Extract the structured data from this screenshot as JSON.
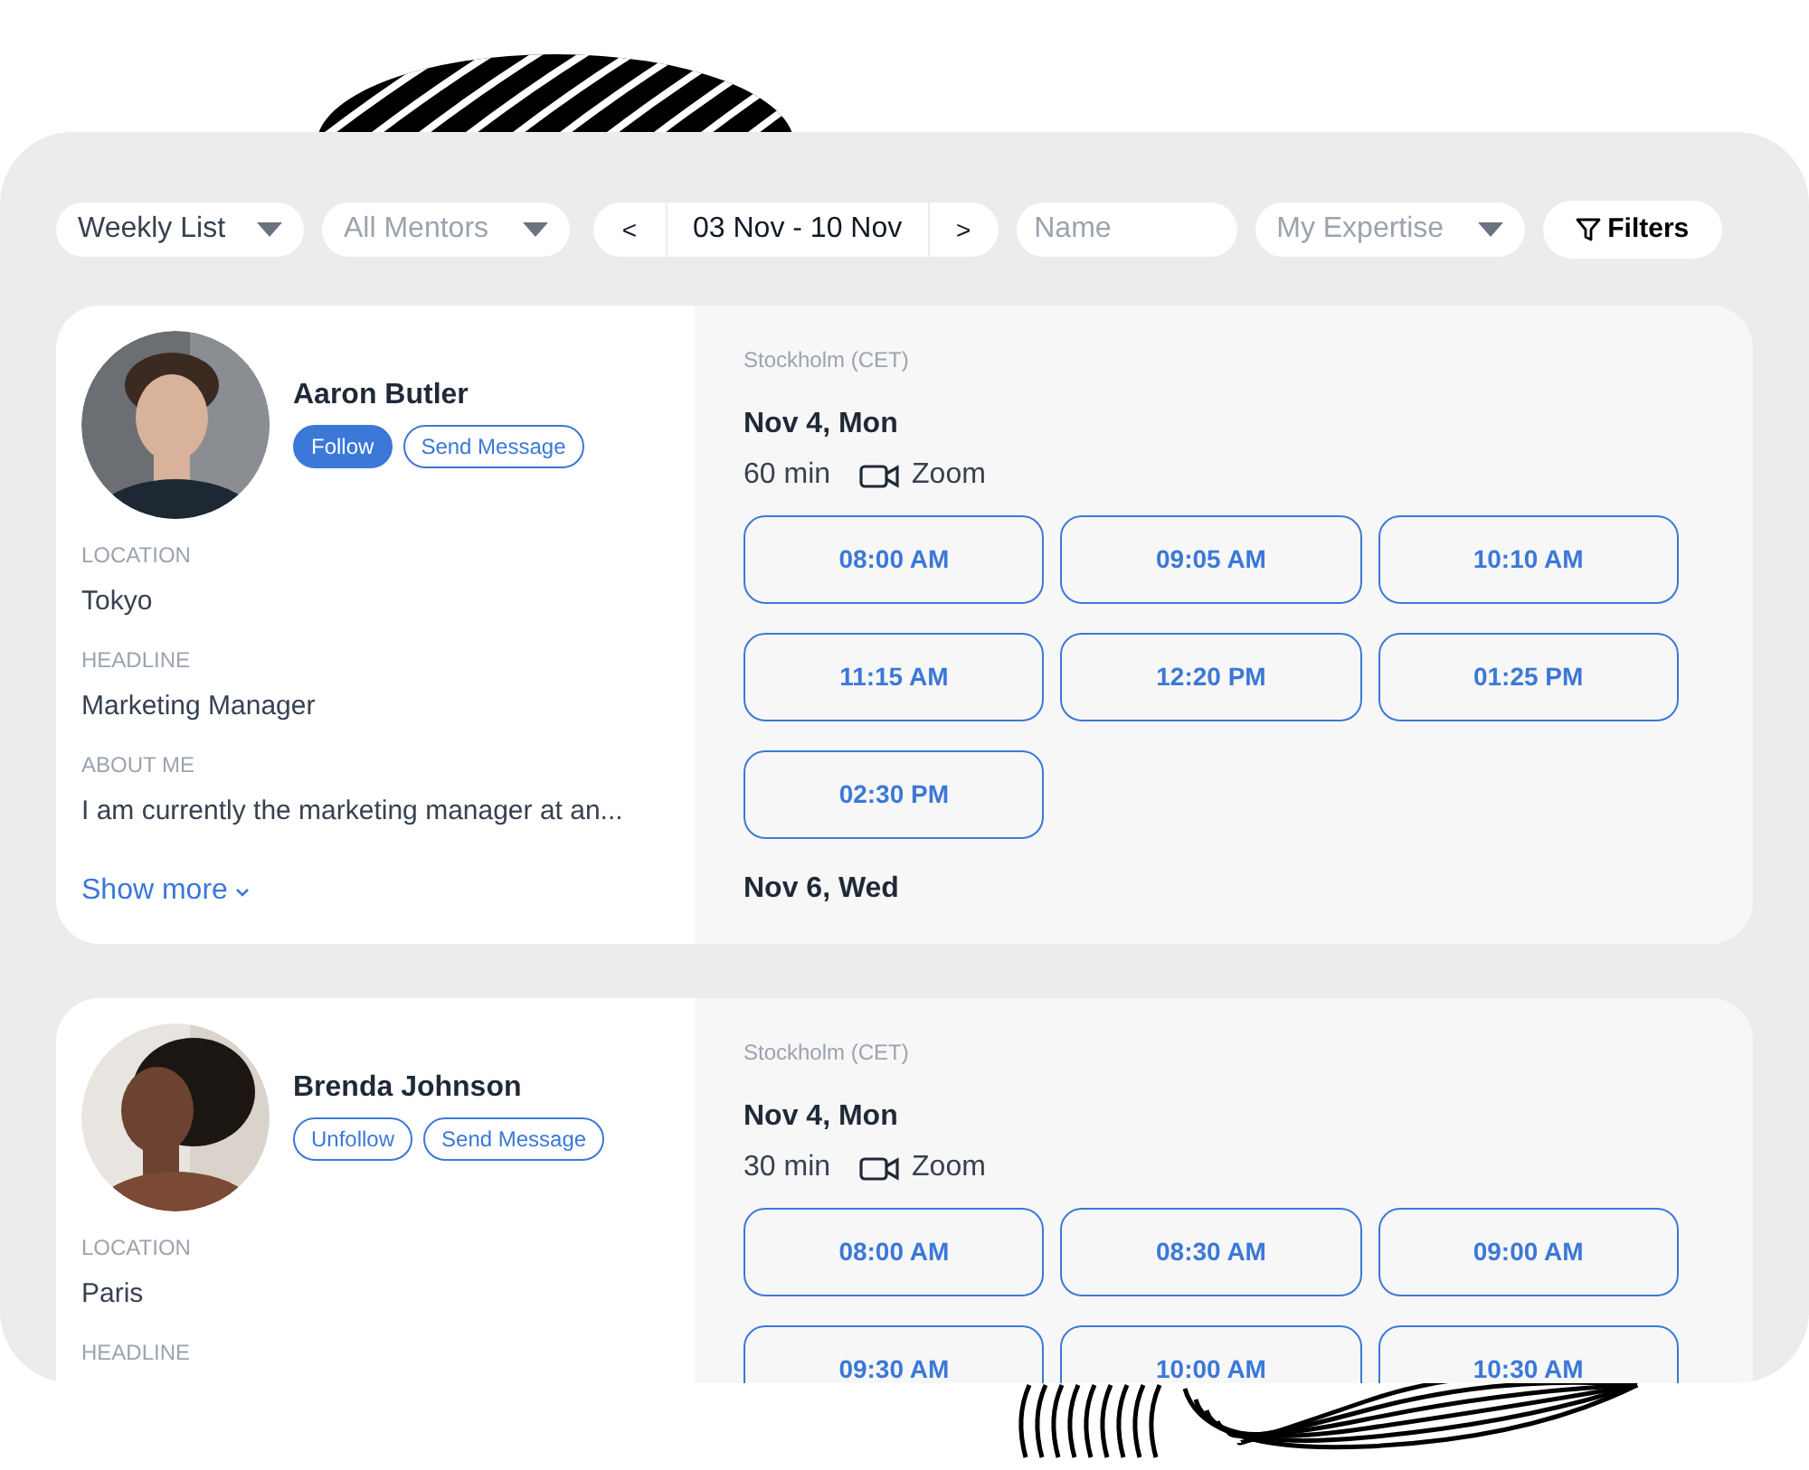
{
  "toolbar": {
    "view_select": {
      "value": "Weekly List"
    },
    "mentor_select": {
      "placeholder": "All Mentors"
    },
    "date_nav": {
      "prev": "<",
      "range": "03 Nov - 10 Nov",
      "next": ">"
    },
    "name_field": {
      "placeholder": "Name"
    },
    "expertise_select": {
      "placeholder": "My Expertise"
    },
    "filters_button": "Filters"
  },
  "mentors": [
    {
      "name": "Aaron Butler",
      "following": false,
      "follow_label": "Follow",
      "message_label": "Send Message",
      "fields": [
        {
          "label": "LOCATION",
          "value": "Tokyo"
        },
        {
          "label": "HEADLINE",
          "value": "Marketing Manager"
        },
        {
          "label": "ABOUT ME",
          "value": "I am currently the marketing manager at an..."
        }
      ],
      "show_more": "Show more",
      "timezone": "Stockholm (CET)",
      "days": [
        {
          "date": "Nov 4, Mon",
          "duration": "60 min",
          "meeting": "Zoom",
          "slots": [
            "08:00 AM",
            "09:05 AM",
            "10:10 AM",
            "11:15 AM",
            "12:20 PM",
            "01:25 PM",
            "02:30 PM"
          ]
        },
        {
          "date": "Nov 6, Wed"
        }
      ]
    },
    {
      "name": "Brenda Johnson",
      "following": true,
      "follow_label": "Unfollow",
      "message_label": "Send Message",
      "fields": [
        {
          "label": "LOCATION",
          "value": "Paris"
        },
        {
          "label": "HEADLINE"
        }
      ],
      "timezone": "Stockholm (CET)",
      "days": [
        {
          "date": "Nov 4, Mon",
          "duration": "30 min",
          "meeting": "Zoom",
          "slots": [
            "08:00 AM",
            "08:30 AM",
            "09:00 AM",
            "09:30 AM",
            "10:00 AM",
            "10:30 AM"
          ]
        }
      ]
    }
  ]
}
